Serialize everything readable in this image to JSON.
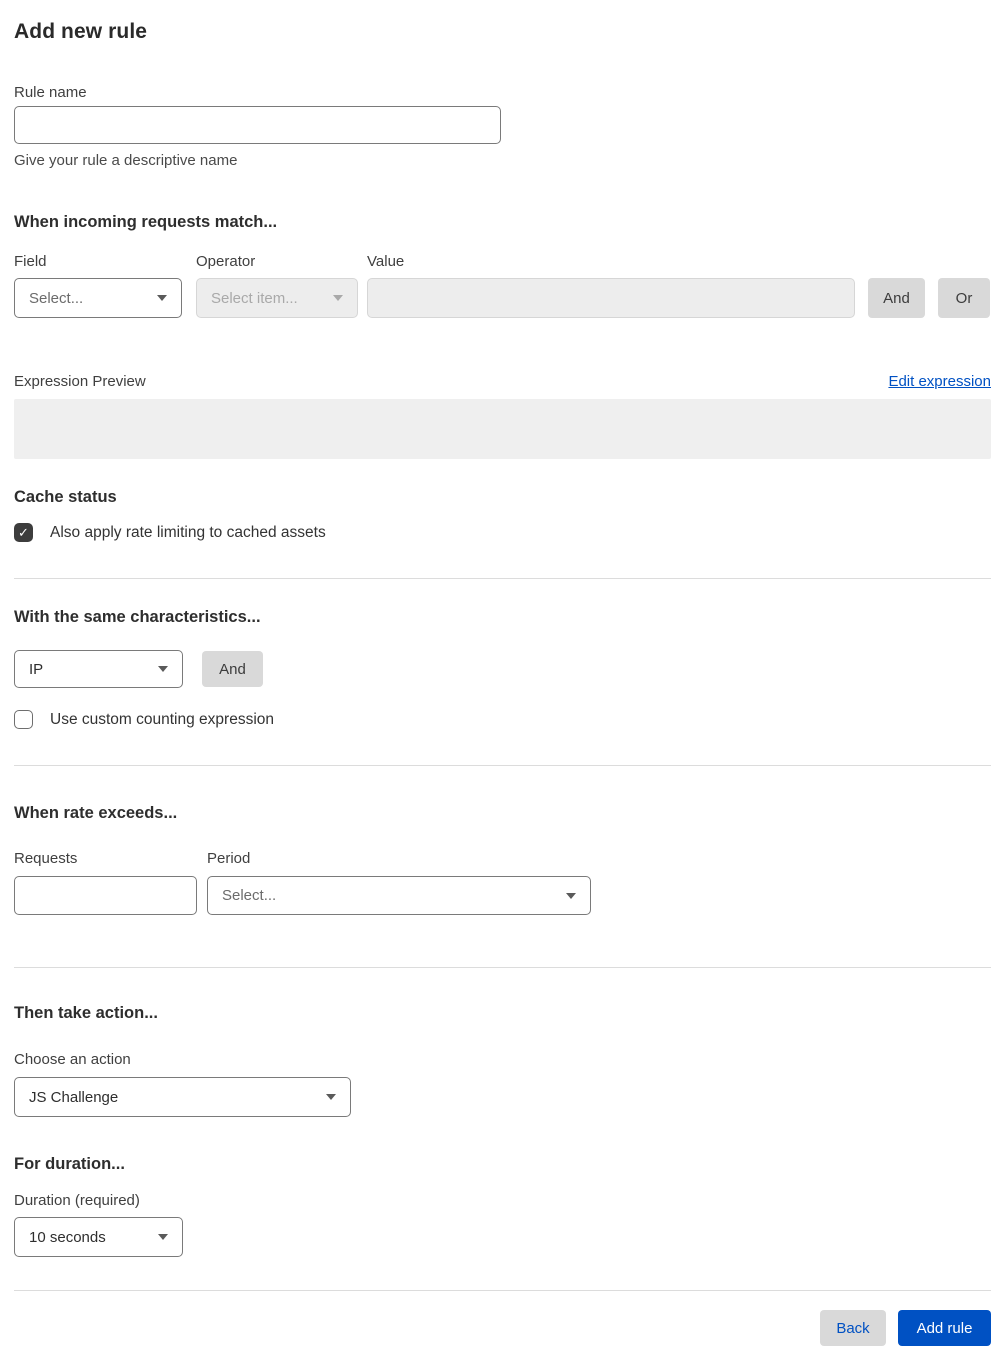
{
  "page": {
    "title": "Add new rule"
  },
  "icons": {
    "check": "✓"
  },
  "colors": {
    "primary_blue": "#0051c3",
    "gray_button": "#d9d9d9",
    "disabled_field_bg": "#ededed",
    "preview_bg": "#efefef",
    "checked_checkbox": "#3d3d3d",
    "divider": "#dcdcdc"
  },
  "rule_name": {
    "label": "Rule name",
    "value": "",
    "helper": "Give your rule a descriptive name"
  },
  "match": {
    "heading": "When incoming requests match...",
    "field_label": "Field",
    "field_value": "Select...",
    "operator_label": "Operator",
    "operator_value": "Select item...",
    "operator_disabled": true,
    "value_label": "Value",
    "value_text": "",
    "value_disabled": true,
    "and_button": "And",
    "or_button": "Or",
    "expression_preview_label": "Expression Preview",
    "edit_expression_link": "Edit expression",
    "expression_value": ""
  },
  "cache_status": {
    "heading": "Cache status",
    "checkbox_label": "Also apply rate limiting to cached assets",
    "checked": true
  },
  "characteristics": {
    "heading": "With the same characteristics...",
    "select_value": "IP",
    "and_button": "And",
    "checkbox_label": "Use custom counting expression",
    "checked": false
  },
  "rate": {
    "heading": "When rate exceeds...",
    "requests_label": "Requests",
    "requests_value": "",
    "period_label": "Period",
    "period_value": "Select..."
  },
  "action": {
    "heading": "Then take action...",
    "label": "Choose an action",
    "value": "JS Challenge"
  },
  "duration": {
    "heading": "For duration...",
    "label": "Duration (required)",
    "value": "10 seconds"
  },
  "footer": {
    "back_button": "Back",
    "submit_button": "Add rule"
  }
}
